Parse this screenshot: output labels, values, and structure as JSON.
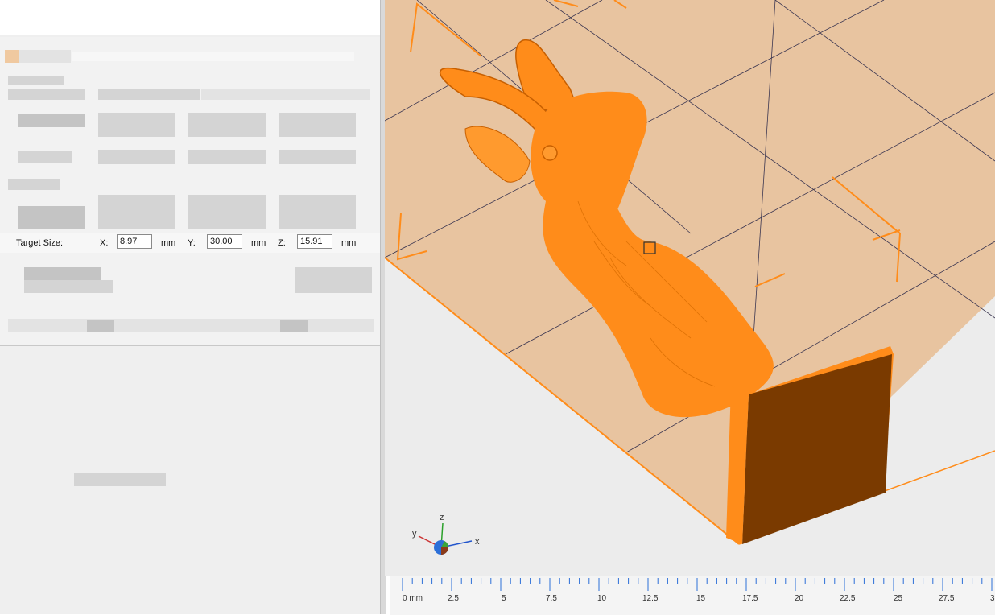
{
  "scale_panel": {
    "target_size_label": "Target Size:",
    "x_label": "X:",
    "y_label": "Y:",
    "z_label": "Z:",
    "x_value": "8.97",
    "y_value": "30.00",
    "z_value": "15.91",
    "unit": "mm"
  },
  "axis_gizmo": {
    "x": "x",
    "y": "y",
    "z": "z"
  },
  "ruler": {
    "labels": [
      "0 mm",
      "2.5",
      "5",
      "7.5",
      "10",
      "12.5",
      "15",
      "17.5",
      "20",
      "22.5",
      "25",
      "27.5",
      "3"
    ]
  },
  "colors": {
    "model_orange": "#ff8c1a",
    "model_dark": "#7a3a00",
    "build_plate": "#e8c4a0",
    "panel_bg": "#efefef"
  },
  "icons": [
    "axis-gizmo-icon",
    "selection-handle-icon"
  ]
}
